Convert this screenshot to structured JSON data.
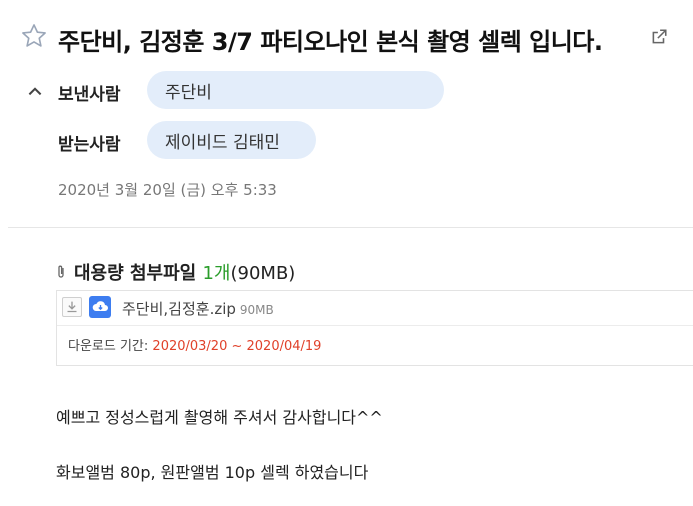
{
  "mail": {
    "subject": "주단비, 김정훈 3/7 파티오나인 본식 촬영 셀렉 입니다.",
    "from_label": "보낸사람",
    "from_name": "주단비",
    "to_label": "받는사람",
    "to_names": "제이비드 김태민",
    "date": "2020년 3월 20일 (금) 오후 5:33"
  },
  "attachments": {
    "title": "대용량 첨부파일",
    "count": "1개",
    "total_size": "(90MB)",
    "files": [
      {
        "name": "주단비,김정훈.zip",
        "size": "90MB"
      }
    ],
    "period_label": "다운로드 기간:",
    "period_range": "2020/03/20 ~ 2020/04/19"
  },
  "body": {
    "lines": [
      "예쁘고 정성스럽게 촬영해 주셔서 감사합니다^^",
      "화보앨범 80p, 원판앨범 10p 셀렉 하였습니다"
    ]
  },
  "icons": {
    "star": "star-outline-icon",
    "external": "open-external-icon",
    "collapse": "chevron-up-icon",
    "clip": "paperclip-icon",
    "download": "download-icon",
    "cloud": "cloud-save-icon"
  },
  "colors": {
    "pill_bg": "#e3edfa",
    "count_green": "#2a9d2a",
    "period_red": "#e0412a",
    "cloud_blue": "#3d7df0"
  }
}
